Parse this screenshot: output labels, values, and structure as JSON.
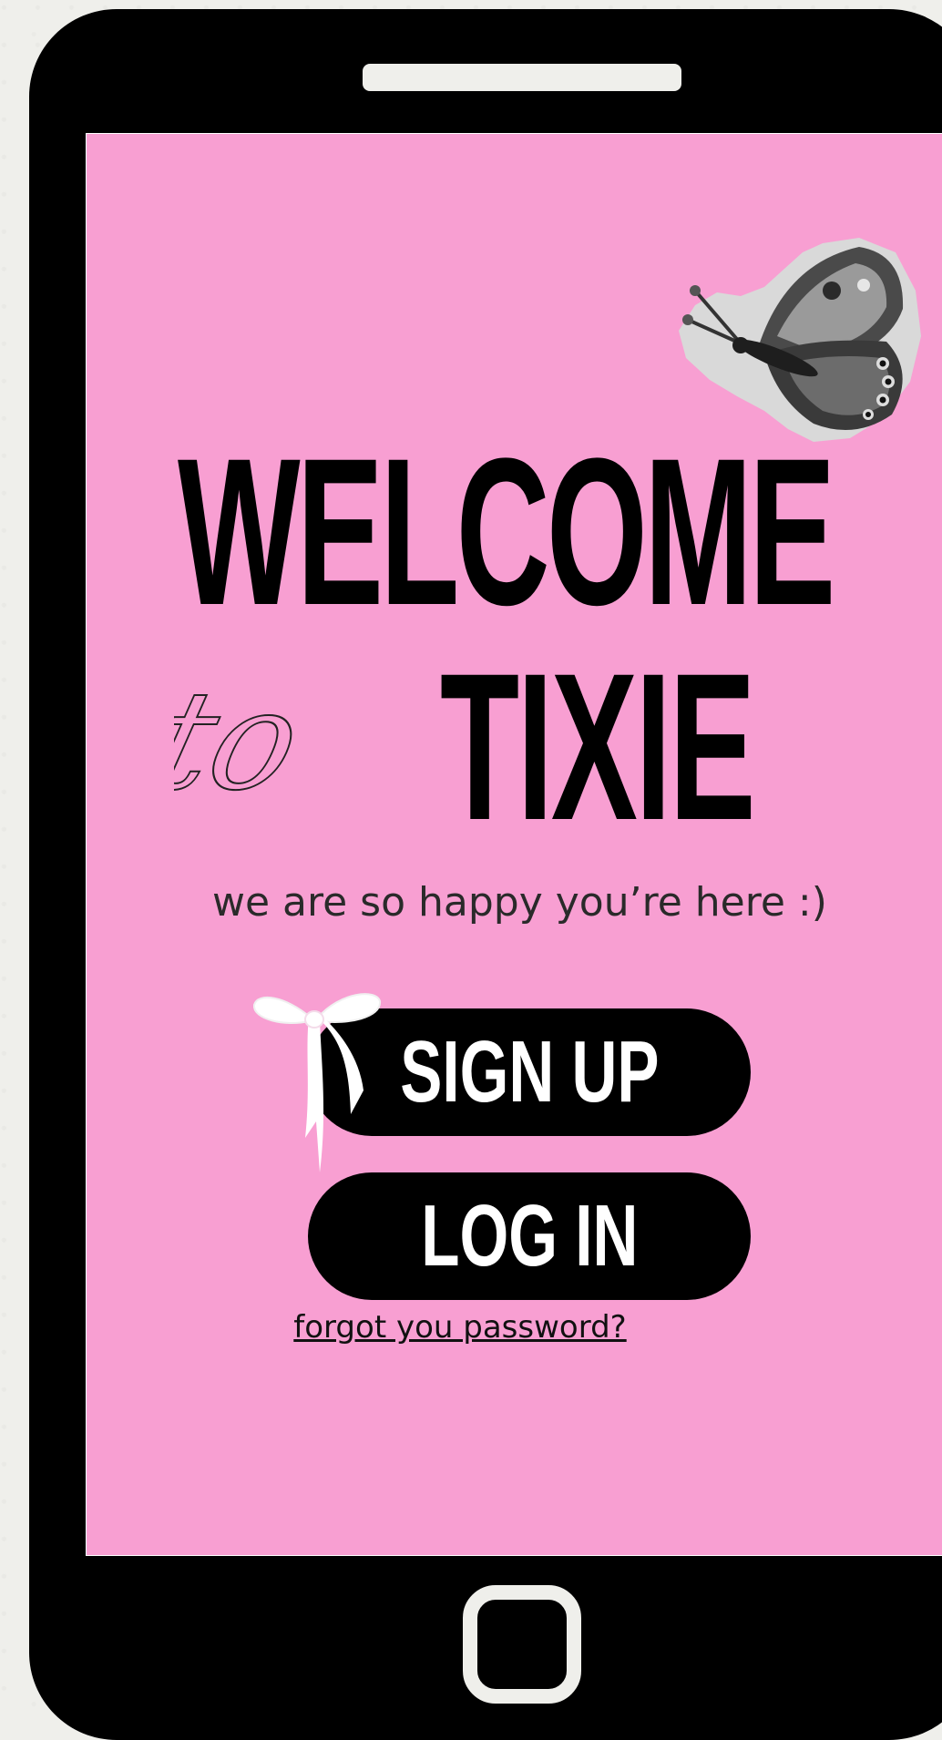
{
  "screen": {
    "heading": "WELCOME",
    "connector": "to",
    "brand": "TIXIE",
    "tagline": "we are so happy you’re here :)",
    "signup_label": "SIGN UP",
    "login_label": "LOG IN",
    "forgot_link": "forgot you password?"
  },
  "colors": {
    "screen_background": "#f89fd2",
    "phone_body": "#000000",
    "button_background": "#000000",
    "button_text": "#ffffff",
    "page_background": "#efefeb"
  },
  "icons": {
    "decoration_top": "butterfly-icon",
    "decoration_button": "ribbon-bow-icon",
    "home": "home-button-icon"
  }
}
